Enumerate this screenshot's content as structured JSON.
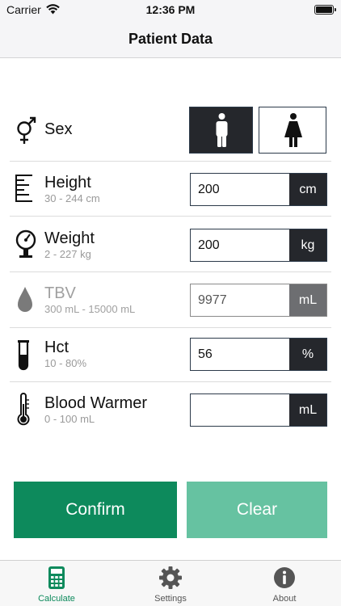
{
  "status_bar": {
    "carrier": "Carrier",
    "time": "12:36 PM"
  },
  "nav": {
    "title": "Patient Data"
  },
  "sex": {
    "label": "Sex",
    "selected": "male"
  },
  "height": {
    "label": "Height",
    "range": "30 - 244 cm",
    "value": "200",
    "unit": "cm"
  },
  "weight": {
    "label": "Weight",
    "range": "2 - 227 kg",
    "value": "200",
    "unit": "kg"
  },
  "tbv": {
    "label": "TBV",
    "range": "300 mL - 15000 mL",
    "value": "9977",
    "unit": "mL"
  },
  "hct": {
    "label": "Hct",
    "range": "10 - 80%",
    "value": "56",
    "unit": "%"
  },
  "blood_warmer": {
    "label": "Blood Warmer",
    "range": "0 - 100 mL",
    "value": "",
    "unit": "mL"
  },
  "actions": {
    "confirm": "Confirm",
    "clear": "Clear"
  },
  "tabs": [
    {
      "label": "Calculate",
      "icon": "calculator-icon"
    },
    {
      "label": "Settings",
      "icon": "gear-icon"
    },
    {
      "label": "About",
      "icon": "info-icon"
    }
  ],
  "colors": {
    "accent": "#0d8a5c",
    "accent_light": "#66c2a1",
    "dark": "#25272c",
    "muted_unit": "#6d6e71"
  }
}
